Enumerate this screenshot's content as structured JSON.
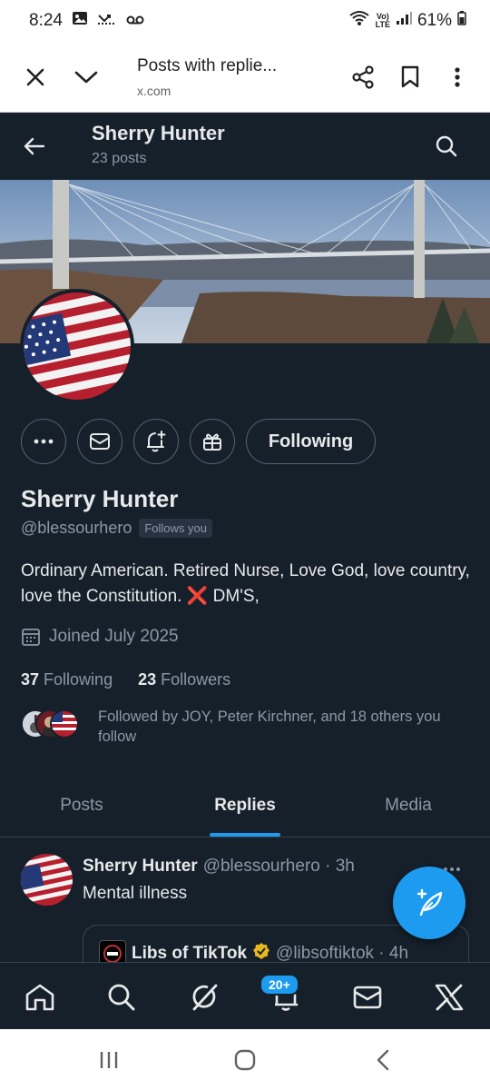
{
  "status_bar": {
    "time": "8:24",
    "battery": "61%"
  },
  "browser": {
    "title": "Posts with replie...",
    "url": "x.com"
  },
  "profile": {
    "header_name": "Sherry Hunter",
    "post_count": "23 posts",
    "name": "Sherry Hunter",
    "handle": "@blessourhero",
    "follows_you": "Follows you",
    "following_button": "Following",
    "bio": "Ordinary American. Retired Nurse,  Love God, love country, love the Constitution.",
    "bio_emoji": "❌",
    "bio_tail": " DM'S,",
    "joined": "Joined July 2025",
    "following_count": "37",
    "following_label": "Following",
    "followers_count": "23",
    "followers_label": "Followers",
    "followed_by": "Followed by JOY, Peter Kirchner, and 18 others you follow"
  },
  "tabs": [
    {
      "label": "Posts",
      "active": false
    },
    {
      "label": "Replies",
      "active": true
    },
    {
      "label": "Media",
      "active": false
    }
  ],
  "post": {
    "name": "Sherry Hunter",
    "meta": "@blessourhero · 3h",
    "text": "Mental illness",
    "quote": {
      "name": "Libs of TikTok",
      "meta": "@libsoftiktok · 4h"
    }
  },
  "bottom_nav": {
    "notifications_badge": "20+"
  },
  "colors": {
    "background": "#15202b",
    "accent": "#1d9bf0",
    "muted": "#8b98a5"
  }
}
